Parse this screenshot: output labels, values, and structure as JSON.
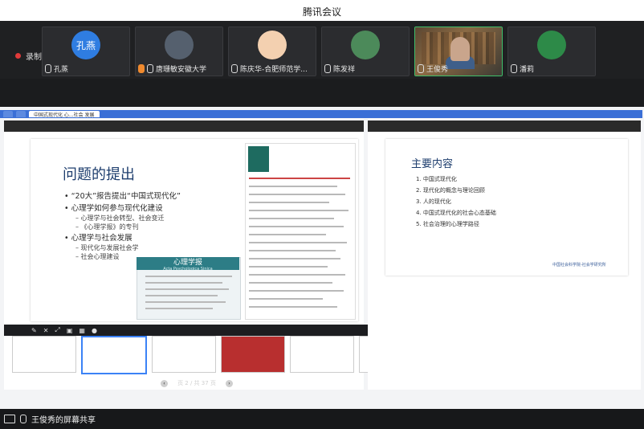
{
  "window": {
    "title": "腾讯会议"
  },
  "recording": {
    "label": "录制中"
  },
  "participants": [
    {
      "name": "孔蒸",
      "avatar_text": "孔燕",
      "avatar_color": "#2f7de1"
    },
    {
      "name": "唐珊敏安徽大学",
      "avatar_text": "",
      "avatar_color": "#55606e"
    },
    {
      "name": "陈庆华-合肥师范学...",
      "avatar_text": "",
      "avatar_color": "#f3d0b0"
    },
    {
      "name": "陈发祥",
      "avatar_text": "",
      "avatar_color": "#4c8a5a"
    },
    {
      "name": "王俊秀",
      "avatar_text": "",
      "avatar_color": "#7a5a3c",
      "speaking": true
    },
    {
      "name": "潘莉",
      "avatar_text": "",
      "avatar_color": "#2d8a48"
    }
  ],
  "browser": {
    "tabs": [
      "",
      "",
      "中国式现代化 心...社会 发展"
    ]
  },
  "left_slide": {
    "title": "问题的提出",
    "bullets": [
      {
        "text": "“20大”报告提出“中国式现代化”",
        "sub": []
      },
      {
        "text": "心理学如何参与现代化建设",
        "sub": [
          "心理学与社会转型、社会变迁",
          "《心理学报》的专刊"
        ]
      },
      {
        "text": "心理学与社会发展",
        "sub": [
          "现代化与发展社会学",
          "社会心理建设"
        ]
      }
    ],
    "journal": {
      "title": "心理学报",
      "subtitle": "Acta Psychologica Sinica"
    }
  },
  "right_slide": {
    "title": "主要内容",
    "items": [
      "1. 中国式现代化",
      "2. 现代化的概念与理论回顾",
      "3. 人的现代化",
      "4. 中国式现代化的社会心态基础",
      "5. 社会治理的心理学路径"
    ],
    "footer": "中国社会科学院-社会学研究所"
  },
  "pager": {
    "text": "页 2 / 共 37 页"
  },
  "share_status": {
    "label": "王俊秀的屏幕共享"
  }
}
